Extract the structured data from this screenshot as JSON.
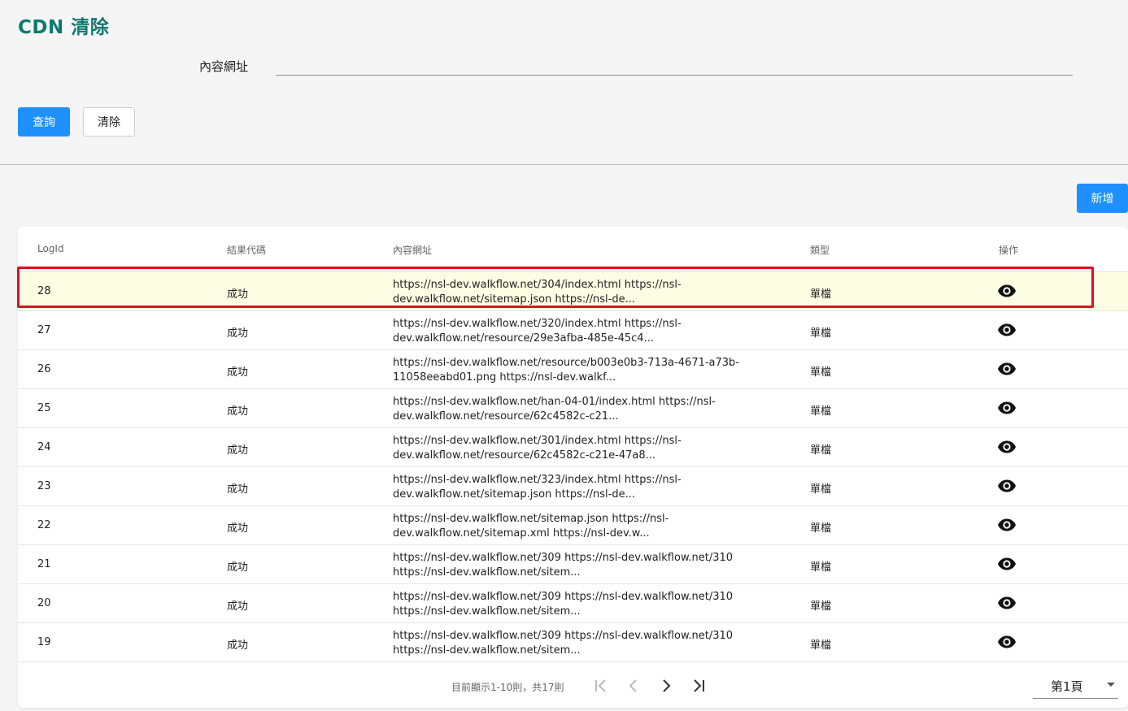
{
  "header": {
    "title": "CDN 清除"
  },
  "search": {
    "label": "內容網址",
    "value": "",
    "placeholder": ""
  },
  "actions": {
    "query_label": "查詢",
    "clear_label": "清除",
    "add_label": "新增"
  },
  "table": {
    "columns": [
      "LogId",
      "結果代碼",
      "內容網址",
      "類型",
      "操作"
    ],
    "selected_row_index": 0,
    "rows": [
      {
        "log_id": "28",
        "result": "成功",
        "url_line1": "https://nsl-dev.walkflow.net/304/index.html https://nsl-",
        "url_line2": "dev.walkflow.net/sitemap.json https://nsl-de...",
        "type": "單檔",
        "action_icon": "eye-icon"
      },
      {
        "log_id": "27",
        "result": "成功",
        "url_line1": "https://nsl-dev.walkflow.net/320/index.html https://nsl-",
        "url_line2": "dev.walkflow.net/resource/29e3afba-485e-45c4...",
        "type": "單檔",
        "action_icon": "eye-icon"
      },
      {
        "log_id": "26",
        "result": "成功",
        "url_line1": "https://nsl-dev.walkflow.net/resource/b003e0b3-713a-4671-a73b-",
        "url_line2": "11058eeabd01.png https://nsl-dev.walkf...",
        "type": "單檔",
        "action_icon": "eye-icon"
      },
      {
        "log_id": "25",
        "result": "成功",
        "url_line1": "https://nsl-dev.walkflow.net/han-04-01/index.html https://nsl-",
        "url_line2": "dev.walkflow.net/resource/62c4582c-c21...",
        "type": "單檔",
        "action_icon": "eye-icon"
      },
      {
        "log_id": "24",
        "result": "成功",
        "url_line1": "https://nsl-dev.walkflow.net/301/index.html https://nsl-",
        "url_line2": "dev.walkflow.net/resource/62c4582c-c21e-47a8...",
        "type": "單檔",
        "action_icon": "eye-icon"
      },
      {
        "log_id": "23",
        "result": "成功",
        "url_line1": "https://nsl-dev.walkflow.net/323/index.html https://nsl-",
        "url_line2": "dev.walkflow.net/sitemap.json https://nsl-de...",
        "type": "單檔",
        "action_icon": "eye-icon"
      },
      {
        "log_id": "22",
        "result": "成功",
        "url_line1": "https://nsl-dev.walkflow.net/sitemap.json https://nsl-",
        "url_line2": "dev.walkflow.net/sitemap.xml https://nsl-dev.w...",
        "type": "單檔",
        "action_icon": "eye-icon"
      },
      {
        "log_id": "21",
        "result": "成功",
        "url_line1": "https://nsl-dev.walkflow.net/309 https://nsl-dev.walkflow.net/310",
        "url_line2": "https://nsl-dev.walkflow.net/sitem...",
        "type": "單檔",
        "action_icon": "eye-icon"
      },
      {
        "log_id": "20",
        "result": "成功",
        "url_line1": "https://nsl-dev.walkflow.net/309 https://nsl-dev.walkflow.net/310",
        "url_line2": "https://nsl-dev.walkflow.net/sitem...",
        "type": "單檔",
        "action_icon": "eye-icon"
      },
      {
        "log_id": "19",
        "result": "成功",
        "url_line1": "https://nsl-dev.walkflow.net/309 https://nsl-dev.walkflow.net/310",
        "url_line2": "https://nsl-dev.walkflow.net/sitem...",
        "type": "單檔",
        "action_icon": "eye-icon"
      }
    ]
  },
  "pagination": {
    "info": "目前顯示1-10則，共17則",
    "current_page_label": "第1頁",
    "first_icon": "first-page-icon",
    "prev_icon": "chevron-left-icon",
    "next_icon": "chevron-right-icon",
    "last_icon": "last-page-icon"
  },
  "colors": {
    "title": "#0e7a6e",
    "primary": "#1e90ff",
    "selected_row_bg": "#fdfde3",
    "highlight_border": "#e0101e"
  }
}
